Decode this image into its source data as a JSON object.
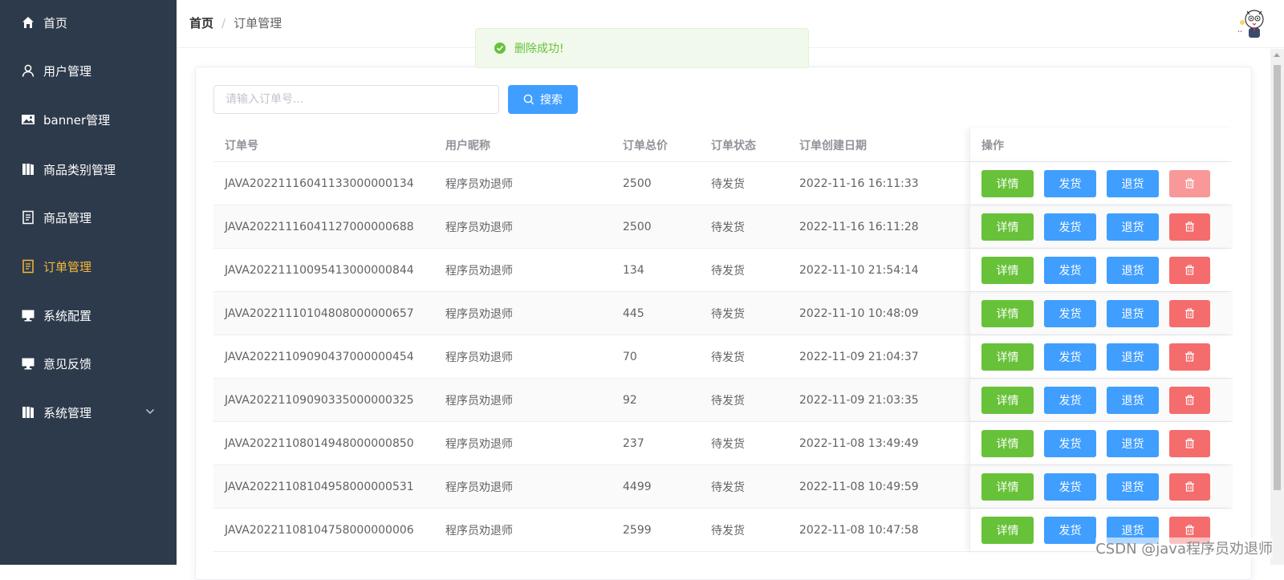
{
  "sidebar": {
    "items": [
      {
        "label": "首页",
        "icon": "home-icon"
      },
      {
        "label": "用户管理",
        "icon": "user-icon"
      },
      {
        "label": "banner管理",
        "icon": "image-icon"
      },
      {
        "label": "商品类别管理",
        "icon": "category-icon"
      },
      {
        "label": "商品管理",
        "icon": "document-icon"
      },
      {
        "label": "订单管理",
        "icon": "document-icon"
      },
      {
        "label": "系统配置",
        "icon": "monitor-icon"
      },
      {
        "label": "意见反馈",
        "icon": "monitor-icon"
      },
      {
        "label": "系统管理",
        "icon": "category-icon"
      }
    ],
    "active_color": "#f4b83a"
  },
  "header": {
    "breadcrumb": {
      "home": "首页",
      "separator": "/",
      "current": "订单管理"
    }
  },
  "toast": {
    "message": "删除成功!"
  },
  "search": {
    "placeholder": "请输入订单号...",
    "button_label": "搜索"
  },
  "table": {
    "headers": {
      "order_no": "订单号",
      "nickname": "用户昵称",
      "total": "订单总价",
      "status": "订单状态",
      "created": "订单创建日期",
      "ops": "操作"
    },
    "buttons": {
      "detail": "详情",
      "ship": "发货",
      "refund": "退货"
    },
    "rows": [
      {
        "order_no": "JAVA20221116041133000000134",
        "nickname": "程序员劝退师",
        "total": "2500",
        "status": "待发货",
        "created": "2022-11-16 16:11:33"
      },
      {
        "order_no": "JAVA20221116041127000000688",
        "nickname": "程序员劝退师",
        "total": "2500",
        "status": "待发货",
        "created": "2022-11-16 16:11:28"
      },
      {
        "order_no": "JAVA20221110095413000000844",
        "nickname": "程序员劝退师",
        "total": "134",
        "status": "待发货",
        "created": "2022-11-10 21:54:14"
      },
      {
        "order_no": "JAVA20221110104808000000657",
        "nickname": "程序员劝退师",
        "total": "445",
        "status": "待发货",
        "created": "2022-11-10 10:48:09"
      },
      {
        "order_no": "JAVA20221109090437000000454",
        "nickname": "程序员劝退师",
        "total": "70",
        "status": "待发货",
        "created": "2022-11-09 21:04:37"
      },
      {
        "order_no": "JAVA20221109090335000000325",
        "nickname": "程序员劝退师",
        "total": "92",
        "status": "待发货",
        "created": "2022-11-09 21:03:35"
      },
      {
        "order_no": "JAVA20221108014948000000850",
        "nickname": "程序员劝退师",
        "total": "237",
        "status": "待发货",
        "created": "2022-11-08 13:49:49"
      },
      {
        "order_no": "JAVA20221108104958000000531",
        "nickname": "程序员劝退师",
        "total": "4499",
        "status": "待发货",
        "created": "2022-11-08 10:49:59"
      },
      {
        "order_no": "JAVA20221108104758000000006",
        "nickname": "程序员劝退师",
        "total": "2599",
        "status": "待发货",
        "created": "2022-11-08 10:47:58"
      }
    ]
  },
  "watermark": "CSDN @java程序员劝退师"
}
